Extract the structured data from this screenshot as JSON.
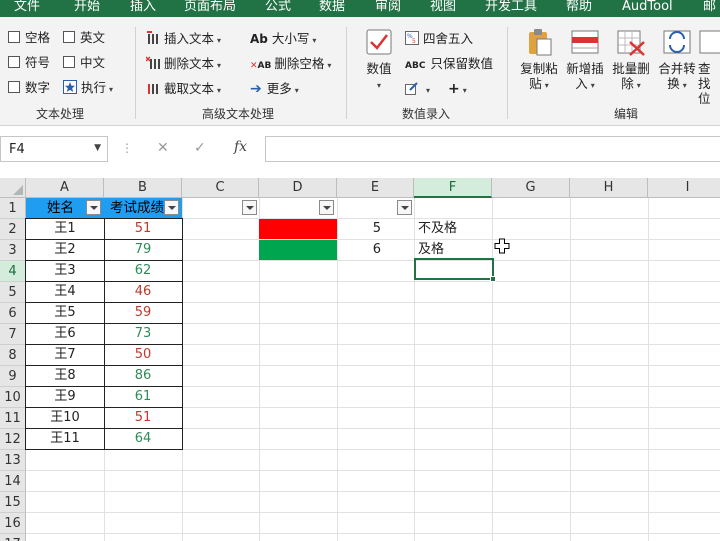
{
  "menu": [
    "文件",
    "开始",
    "插入",
    "页面布局",
    "公式",
    "数据",
    "审阅",
    "视图",
    "开发工具",
    "帮助",
    "AudTool",
    "邮"
  ],
  "ribbon": {
    "text_processing": {
      "label": "文本处理",
      "options": [
        "空格",
        "英文",
        "符号",
        "中文",
        "数字",
        "执行"
      ]
    },
    "advanced_text": {
      "label": "高级文本处理",
      "insert_text": "插入文本",
      "delete_text": "删除文本",
      "extract_text": "截取文本",
      "case": "大小写",
      "delete_spaces": "删除空格",
      "more": "更多"
    },
    "numeric_entry": {
      "label": "数值录入",
      "value": "数值",
      "round": "四舍五入",
      "keep_values": "只保留数值"
    },
    "edit": {
      "label": "编辑",
      "copy_paste": [
        "复制粘",
        "贴"
      ],
      "insert_new": [
        "新增插",
        "入"
      ],
      "batch_delete": [
        "批量删",
        "除"
      ],
      "merge_convert": [
        "合并转",
        "换"
      ],
      "find_locate": [
        "查找",
        "位"
      ]
    }
  },
  "formula_bar": {
    "cell_ref": "F4",
    "cancel": "✕",
    "confirm": "✓",
    "fx": "fx",
    "content": ""
  },
  "sheet": {
    "columns": [
      "A",
      "B",
      "C",
      "D",
      "E",
      "F",
      "G",
      "H",
      "I"
    ],
    "rows": [
      "1",
      "2",
      "3",
      "4",
      "5",
      "6",
      "7",
      "8",
      "9",
      "10",
      "11",
      "12",
      "13",
      "14",
      "15",
      "16",
      "17"
    ],
    "header_name": "姓名",
    "header_score": "考试成绩",
    "students": [
      {
        "name": "王1",
        "score": "51"
      },
      {
        "name": "王2",
        "score": "79"
      },
      {
        "name": "王3",
        "score": "62"
      },
      {
        "name": "王4",
        "score": "46"
      },
      {
        "name": "王5",
        "score": "59"
      },
      {
        "name": "王6",
        "score": "73"
      },
      {
        "name": "王7",
        "score": "50"
      },
      {
        "name": "王8",
        "score": "86"
      },
      {
        "name": "王9",
        "score": "61"
      },
      {
        "name": "王10",
        "score": "51"
      },
      {
        "name": "王11",
        "score": "64"
      }
    ],
    "legend": [
      {
        "code": "5",
        "label": "不及格"
      },
      {
        "code": "6",
        "label": "及格"
      }
    ],
    "selected_cell": "F4"
  },
  "colors": {
    "excel_green": "#217346",
    "header_blue": "#1f9df0",
    "fail_red": "#c0392b",
    "pass_green": "#2e8b57",
    "legend_red": "#ff0000",
    "legend_green": "#00a550"
  }
}
